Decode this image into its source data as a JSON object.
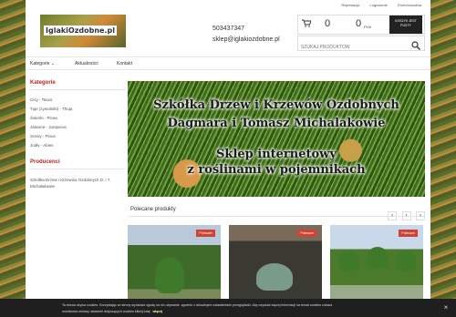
{
  "toplinks": {
    "register": "Rejestracja",
    "login": "Logowanie",
    "watched": "Przechowalnia"
  },
  "logo": {
    "text": "IglakiOzdobne.pl"
  },
  "contact": {
    "phone": "503437347",
    "email": "sklep@iglakiozdobne.pl"
  },
  "cart": {
    "count": "0",
    "total": "0",
    "currency": "PLN",
    "button_label": "KOSZYK JEST PUSTY"
  },
  "search": {
    "placeholder": "SZUKAJ PRODUKTÓW"
  },
  "nav": {
    "items": [
      "Kategorie",
      "Aktualności",
      "Kontakt"
    ]
  },
  "sidebar": {
    "categories_title": "Kategorie",
    "categories": [
      "Cisy - Taxus",
      "Tuje (żywotniki) - Thuja",
      "Świerki - Picea",
      "Jałowce - Juniperus",
      "Sosny - Pinus",
      "Jodły - Abies"
    ],
    "producers_title": "Producenci",
    "producer": "Szkółka Drzew i Krzewów Ozdobnych D. i T. Michalakowie"
  },
  "banner": {
    "line1": "Szkółka Drzew i Krzewów Ozdobnych",
    "line2": "Dagmara i Tomasz Michalakowie",
    "line3": "Sklep internetowy",
    "line4": "z roślinami w pojemnikach"
  },
  "featured": {
    "title": "Polecane produkty",
    "badge": "Polecane"
  },
  "cookie": {
    "line1": "Ta strona używa cookies. Korzystając ze strony wyrażasz zgodę na ich używanie, zgodnie z aktualnymi ustawieniami przeglądarki. Aby uzyskać więcej informacji na temat cookies zobacz",
    "line2": "możliwości zmiany ustawień dotyczących cookies kliknij tutaj",
    "more": "więcej"
  }
}
